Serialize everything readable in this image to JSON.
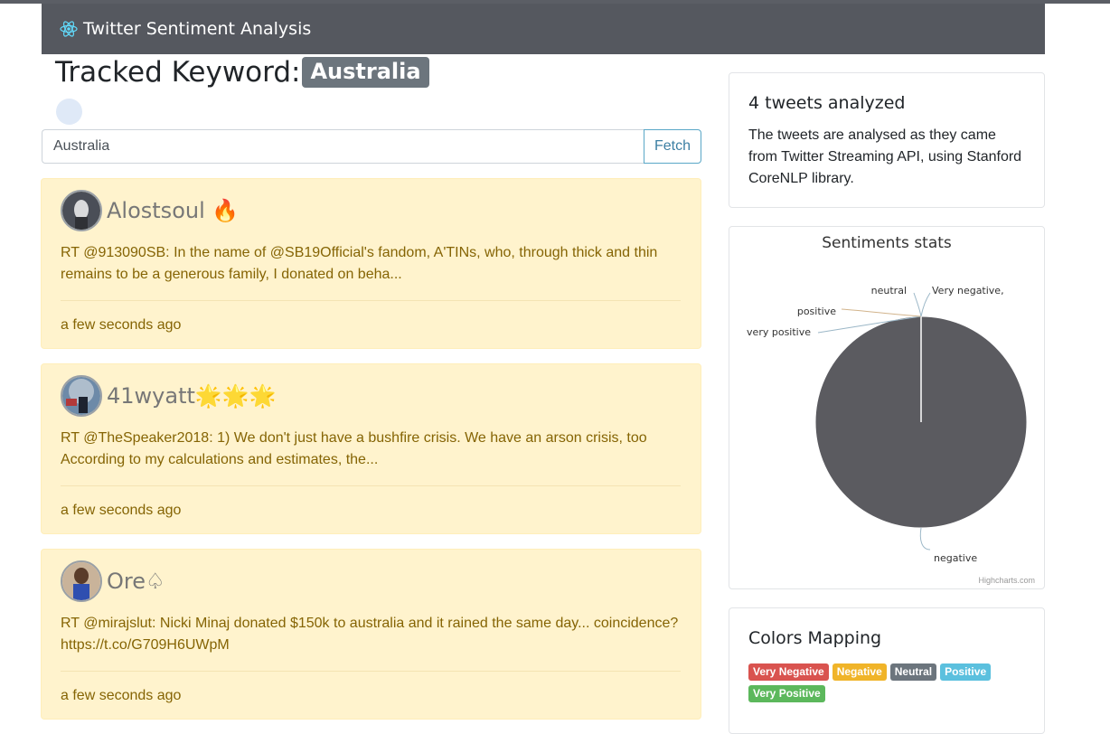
{
  "app": {
    "title": "Twitter Sentiment Analysis"
  },
  "header": {
    "title_prefix": "Tracked Keyword:",
    "keyword": "Australia"
  },
  "search": {
    "value": "Australia",
    "button": "Fetch"
  },
  "tweets": [
    {
      "user": "Alostsoul 🔥",
      "text": "RT @913090SB: In the name of @SB19Official's fandom, A'TINs, who, through thick and thin remains to be a generous family, I donated on beha...",
      "time": "a few seconds ago"
    },
    {
      "user": "41wyatt🌟🌟🌟",
      "text": "RT @TheSpeaker2018: 1) We don't just have a bushfire crisis. We have an arson crisis, too According to my calculations and estimates, the...",
      "time": "a few seconds ago"
    },
    {
      "user": "Ore♤",
      "text": "RT @mirajslut: Nicki Minaj donated $150k to australia and it rained the same day... coincidence? https://t.co/G709H6UWpM",
      "time": "a few seconds ago"
    }
  ],
  "summary": {
    "title": "4 tweets analyzed",
    "text": "The tweets are analysed as they came from Twitter Streaming API, using Stanford CoreNLP library."
  },
  "chart_data": {
    "type": "pie",
    "title": "Sentiments stats",
    "labels": [
      "negative",
      "very positive",
      "positive",
      "neutral",
      "Very negative"
    ],
    "values": [
      4,
      0,
      0,
      0,
      0
    ],
    "colors": [
      "#5b5b60"
    ],
    "credits": "Highcharts.com"
  },
  "colors_mapping": {
    "title": "Colors Mapping",
    "badges": [
      {
        "label": "Very Negative",
        "color": "#d9534f"
      },
      {
        "label": "Negative",
        "color": "#f0b429"
      },
      {
        "label": "Neutral",
        "color": "#6c757d"
      },
      {
        "label": "Positive",
        "color": "#5bc0de"
      },
      {
        "label": "Very Positive",
        "color": "#5cb85c"
      }
    ]
  }
}
